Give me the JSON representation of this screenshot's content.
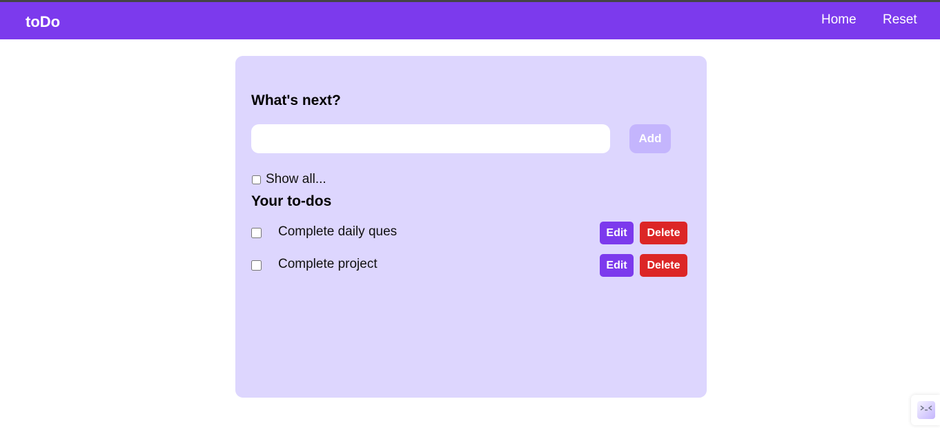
{
  "navbar": {
    "brand": "toDo",
    "links": [
      "Home",
      "Reset"
    ],
    "background": "#7c3aed"
  },
  "card": {
    "background": "#ddd6fe",
    "input_heading": "What's next?",
    "input_value": "",
    "input_placeholder": "",
    "add_label": "Add",
    "show_all_label": "Show all...",
    "show_all_checked": false,
    "list_heading": "Your to-dos"
  },
  "todos": [
    {
      "text": "Complete daily ques",
      "completed": false,
      "edit_label": "Edit",
      "delete_label": "Delete"
    },
    {
      "text": "Complete project",
      "completed": false,
      "edit_label": "Edit",
      "delete_label": "Delete"
    }
  ],
  "colors": {
    "accent": "#7c3aed",
    "danger": "#dc2626",
    "add_disabled": "#c4b5fd"
  },
  "icons": {
    "corner_widget": "devtools-icon"
  }
}
